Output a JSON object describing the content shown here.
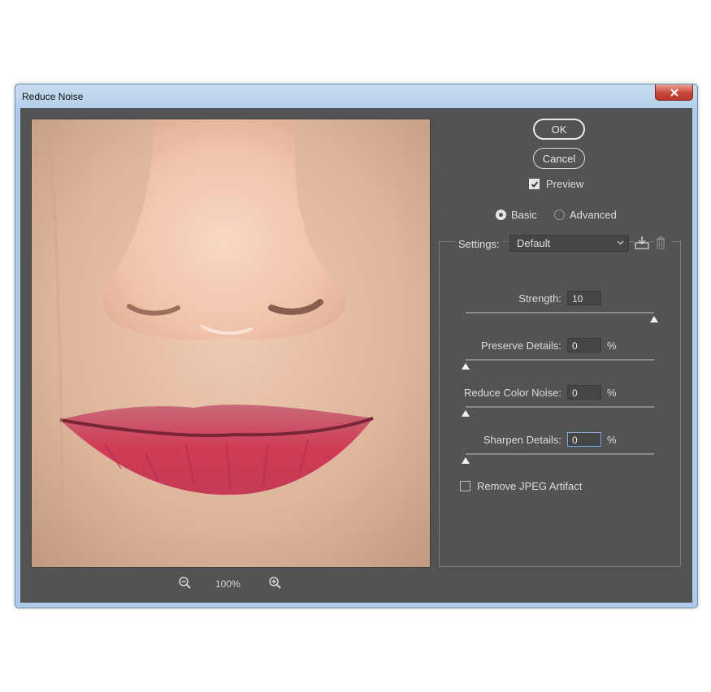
{
  "window": {
    "title": "Reduce Noise"
  },
  "buttons": {
    "ok_label": "OK",
    "cancel_label": "Cancel"
  },
  "preview": {
    "label": "Preview",
    "checked": true
  },
  "mode": {
    "basic_label": "Basic",
    "advanced_label": "Advanced",
    "selected": "Basic"
  },
  "settings": {
    "label": "Settings:",
    "selected": "Default"
  },
  "sliders": {
    "strength": {
      "label": "Strength:",
      "value": "10",
      "unit": "",
      "fraction": 1.0
    },
    "preserve_details": {
      "label": "Preserve Details:",
      "value": "0",
      "unit": "%",
      "fraction": 0.0
    },
    "reduce_color_noise": {
      "label": "Reduce Color Noise:",
      "value": "0",
      "unit": "%",
      "fraction": 0.0
    },
    "sharpen_details": {
      "label": "Sharpen Details:",
      "value": "0",
      "unit": "%",
      "fraction": 0.0
    }
  },
  "jpeg": {
    "label": "Remove JPEG Artifact",
    "checked": false
  },
  "zoom": {
    "level": "100%"
  },
  "colors": {
    "dialog_bg": "#535353",
    "titlebar": "#c9ddf2",
    "close_button": "#c8473a"
  }
}
